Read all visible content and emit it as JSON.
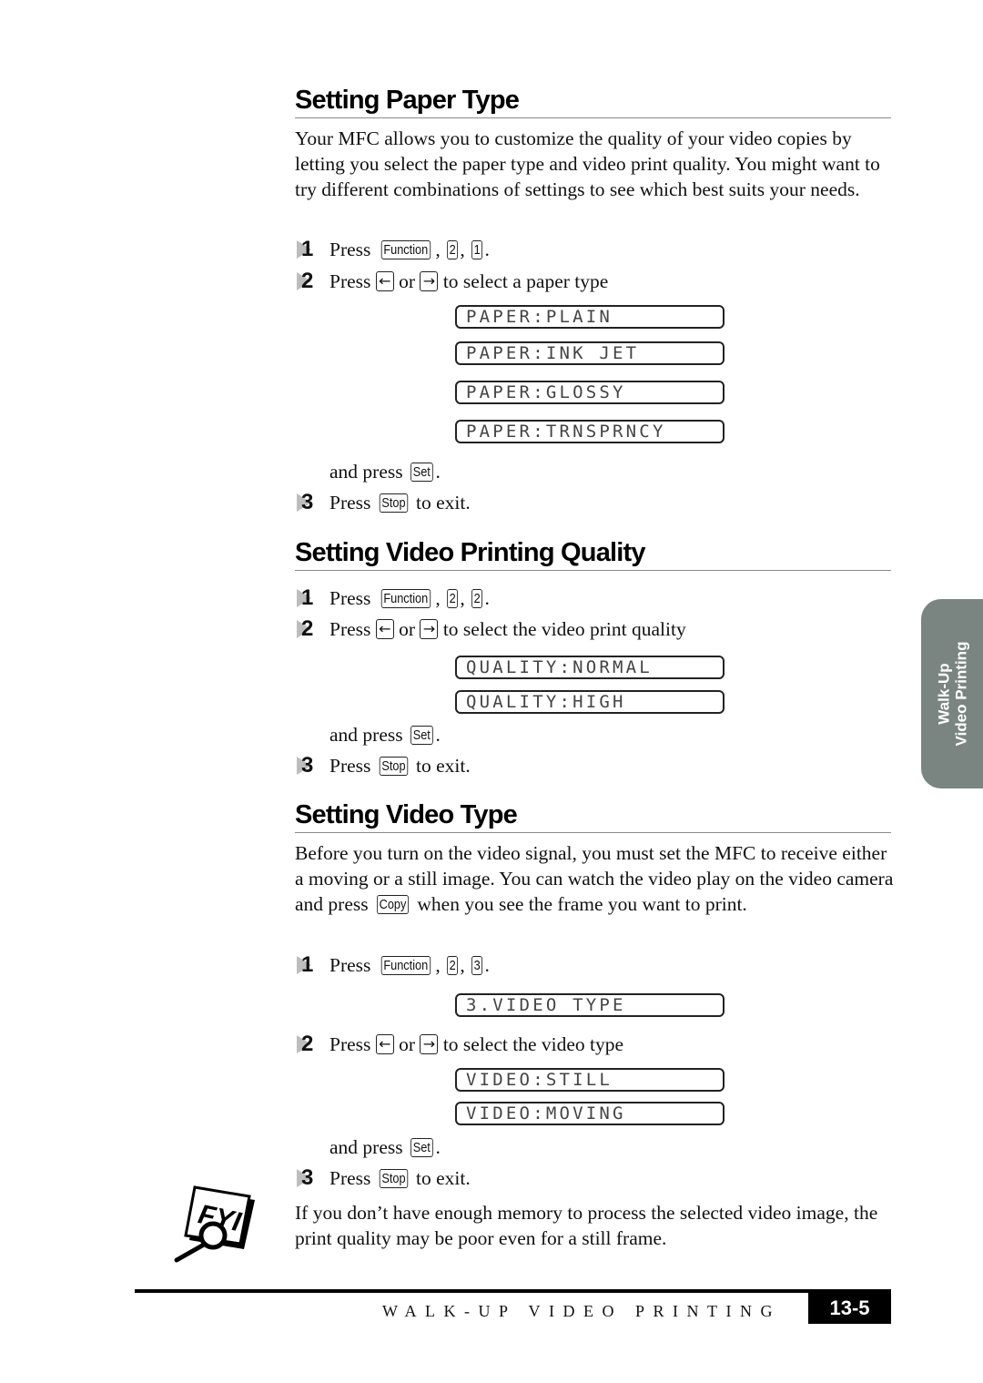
{
  "sections": [
    {
      "title": "Setting Paper Type",
      "intro": "Your MFC allows you to customize the quality of your video copies by letting you select the paper type and video print quality. You might want to try different combinations of settings to see which best suits your needs.",
      "step1": {
        "num": "1",
        "press": "Press",
        "keys": [
          "Function",
          "2",
          "1"
        ]
      },
      "step2": {
        "num": "2",
        "press": "Press",
        "or": "or",
        "left_key": "←",
        "right_key": "→",
        "text": "to select a paper type"
      },
      "lcd": [
        "PAPER:PLAIN",
        "PAPER:INK JET",
        "PAPER:GLOSSY",
        "PAPER:TRNSPRNCY"
      ],
      "and_press": "and press",
      "set_key": "Set",
      "step3": {
        "num": "3",
        "press": "Press",
        "key": "Stop",
        "text": "to exit."
      }
    },
    {
      "title": "Setting Video Printing Quality",
      "step1": {
        "num": "1",
        "press": "Press",
        "keys": [
          "Function",
          "2",
          "2"
        ]
      },
      "step2": {
        "num": "2",
        "press": "Press",
        "or": "or",
        "left_key": "←",
        "right_key": "→",
        "text": "to select the video print quality"
      },
      "lcd": [
        "QUALITY:NORMAL",
        "QUALITY:HIGH"
      ],
      "and_press": "and press",
      "set_key": "Set",
      "step3": {
        "num": "3",
        "press": "Press",
        "key": "Stop",
        "text": "to exit."
      }
    },
    {
      "title": "Setting Video Type",
      "intro_a": "Before you turn on the video signal, you must set the MFC to receive either a moving or a still image. You can watch the video play on the video camera and press",
      "intro_key": "Copy",
      "intro_b": "when you see the frame you want to print.",
      "step1": {
        "num": "1",
        "press": "Press",
        "keys": [
          "Function",
          "2",
          "3"
        ]
      },
      "lcd_menu": "3.VIDEO TYPE",
      "step2": {
        "num": "2",
        "press": "Press",
        "or": "or",
        "left_key": "←",
        "right_key": "→",
        "text": "to select the video type"
      },
      "lcd": [
        "VIDEO:STILL",
        "VIDEO:MOVING"
      ],
      "and_press": "and press",
      "set_key": "Set",
      "step3": {
        "num": "3",
        "press": "Press",
        "key": "Stop",
        "text": "to exit."
      }
    }
  ],
  "fyi": {
    "icon": "fyi-magnifier-icon",
    "label": "FYI",
    "text": "If you don’t have enough memory to process the selected video image, the print quality may be poor even for a still frame."
  },
  "side_tab": {
    "line1": "Walk-Up",
    "line2": "Video Printing"
  },
  "footer": {
    "text": "WALK-UP VIDEO PRINTING",
    "page": "13-5"
  }
}
